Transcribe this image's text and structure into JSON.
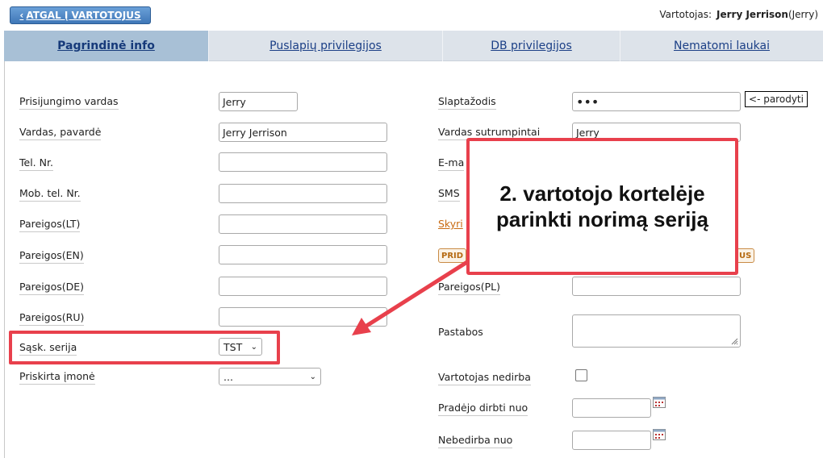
{
  "header": {
    "back_label": "ATGAL Į VARTOTOJUS",
    "user_prefix": "Vartotojas:",
    "user_name": "Jerry Jerrison",
    "user_login_paren": "(Jerry)"
  },
  "tabs": [
    {
      "label": "Pagrindinė info",
      "active": true
    },
    {
      "label": "Puslapių privilegijos",
      "active": false
    },
    {
      "label": "DB privilegijos",
      "active": false
    },
    {
      "label": "Nematomi laukai",
      "active": false
    }
  ],
  "left_form": {
    "login_label": "Prisijungimo vardas",
    "login_value": "Jerry",
    "name_label": "Vardas, pavardė",
    "name_value": "Jerry Jerrison",
    "tel_label": "Tel. Nr.",
    "mob_label": "Mob. tel. Nr.",
    "pos_lt_label": "Pareigos(LT)",
    "pos_en_label": "Pareigos(EN)",
    "pos_de_label": "Pareigos(DE)",
    "pos_ru_label": "Pareigos(RU)",
    "series_label": "Sąsk. serija",
    "series_value": "TST",
    "company_label": "Priskirta įmonė",
    "company_value": "..."
  },
  "right_form": {
    "password_label": "Slaptažodis",
    "password_value": "•••",
    "show_button": "<- parodyti",
    "short_name_label": "Vardas sutrumpintai",
    "short_name_value": "Jerry",
    "email_label_partial": "E-ma",
    "sms_label": "SMS",
    "departments_link_partial": "Skyri",
    "pill_left_partial": "PRID",
    "pill_right_partial": "US",
    "pos_pl_label": "Pareigos(PL)",
    "notes_label": "Pastabos",
    "inactive_label": "Vartotojas nedirba",
    "start_label": "Pradėjo dirbti nuo",
    "end_label": "Nebedirba nuo"
  },
  "annotation": {
    "callout_line1": "2. vartotojo kortelėje",
    "callout_line2": "parinkti norimą seriją",
    "accent_color": "#e8404c"
  },
  "icons": {
    "back": "chevron-left-icon",
    "dropdown": "chevron-down-icon",
    "calendar": "calendar-icon",
    "resize": "resize-grip-icon"
  }
}
